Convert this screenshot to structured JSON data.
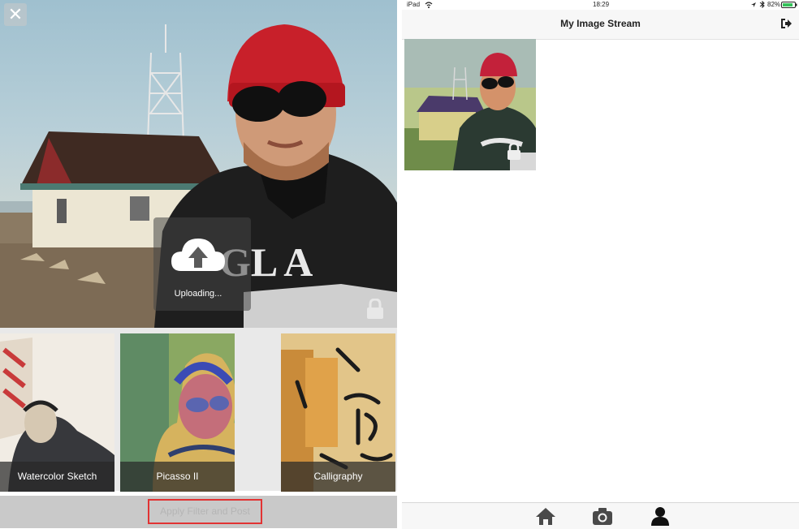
{
  "editor": {
    "close_glyph": "✕",
    "upload_status": "Uploading...",
    "filters": [
      {
        "label": "Watercolor Sketch"
      },
      {
        "label": "Picasso II"
      },
      {
        "label": "Calligraphy"
      }
    ],
    "apply_button_label": "Apply Filter and Post"
  },
  "stream": {
    "status_bar": {
      "device": "iPad",
      "time": "18:29",
      "battery": "82%"
    },
    "title": "My Image Stream",
    "tabs": [
      {
        "name": "home-icon"
      },
      {
        "name": "camera-icon"
      },
      {
        "name": "profile-icon"
      }
    ]
  },
  "colors": {
    "highlight": "#e23333",
    "accent": "#222222"
  }
}
